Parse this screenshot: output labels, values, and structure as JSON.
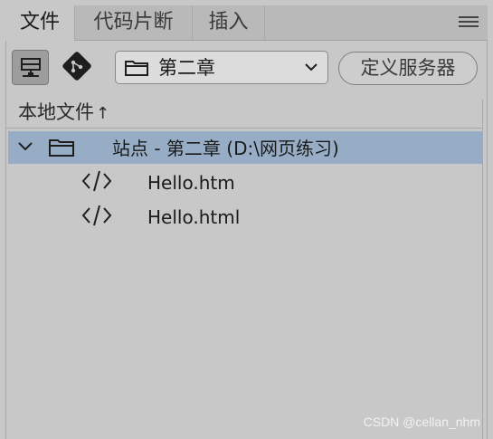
{
  "tabs": [
    {
      "label": "文件",
      "active": true
    },
    {
      "label": "代码片断",
      "active": false
    },
    {
      "label": "插入",
      "active": false
    }
  ],
  "toolbar": {
    "site_select_value": "第二章",
    "define_server_label": "定义服务器"
  },
  "file_panel": {
    "column_header": "本地文件",
    "sort_indicator": "↑"
  },
  "tree": {
    "site_label": "站点 - 第二章 (D:\\网页练习)",
    "files": [
      "Hello.htm",
      "Hello.html"
    ]
  },
  "watermark": "CSDN @cellan_nhm",
  "colors": {
    "panel_bg": "#c8c8c8",
    "selected_row": "#97adc6"
  }
}
